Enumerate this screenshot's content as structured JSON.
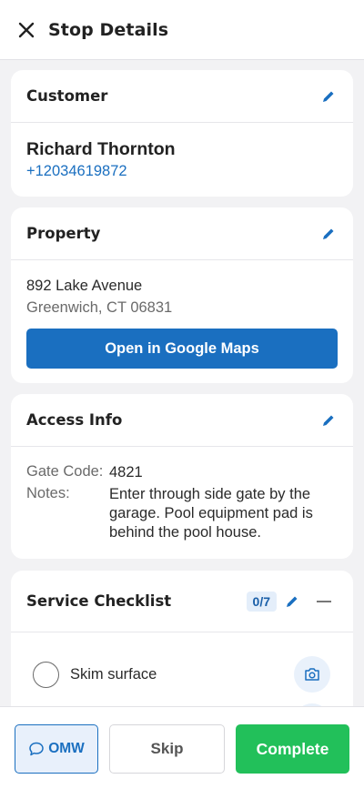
{
  "header": {
    "title": "Stop Details",
    "close_icon": "close-icon"
  },
  "customer": {
    "section_title": "Customer",
    "name": "Richard Thornton",
    "phone": "+12034619872"
  },
  "property": {
    "section_title": "Property",
    "address_line1": "892 Lake Avenue",
    "address_line2": "Greenwich, CT 06831",
    "maps_button": "Open in Google Maps"
  },
  "access": {
    "section_title": "Access Info",
    "gate_code_label": "Gate Code:",
    "gate_code": "4821",
    "notes_label": "Notes:",
    "notes": "Enter through side gate by the garage. Pool equipment pad is behind the pool house."
  },
  "checklist": {
    "section_title": "Service Checklist",
    "progress": "0/7",
    "completed": 0,
    "total": 7,
    "items": [
      {
        "label": "Skim surface",
        "checked": false
      },
      {
        "label": "",
        "checked": false
      }
    ]
  },
  "actions": {
    "omw": "OMW",
    "skip": "Skip",
    "complete": "Complete"
  },
  "colors": {
    "accent": "#1a6fc0",
    "complete": "#22c05a",
    "background": "#f2f2f4"
  }
}
